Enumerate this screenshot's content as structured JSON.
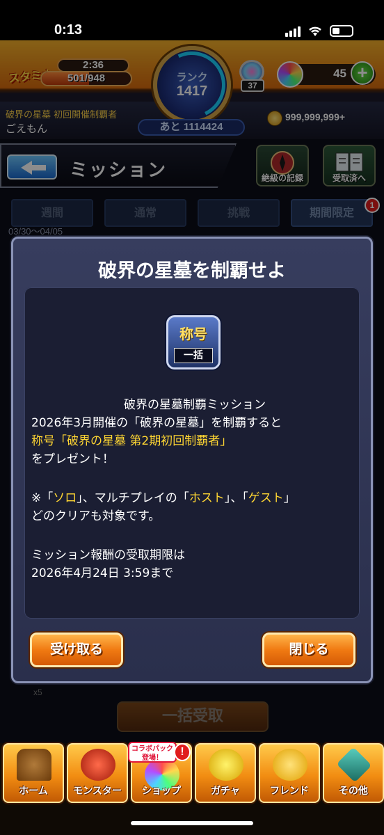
{
  "status_bar": {
    "time": "0:13"
  },
  "header": {
    "stamina_label": "スタミナ",
    "stamina_timer": "2:36",
    "stamina_value": "501/948",
    "stamina_fraction": 0.53,
    "rank_label": "ランク",
    "rank_value": "1417",
    "rank_next": "あと 1114424",
    "bag_count": "37",
    "orb_count": "45",
    "player_title": "破界の星墓 初回開催制覇者",
    "player_name": "ごえもん",
    "gold": "999,999,999+"
  },
  "nav": {
    "page_title": "ミッション",
    "record_label": "絶級の記録",
    "received_label": "受取済へ"
  },
  "tabs": [
    {
      "label": "週間"
    },
    {
      "label": "通常"
    },
    {
      "label": "挑戦"
    },
    {
      "label": "期間限定"
    }
  ],
  "tab_badge": "1",
  "date_range": "03/30〜04/05",
  "modal": {
    "title": "破界の星墓を制覇せよ",
    "reward_top": "称号",
    "reward_bottom": "一括",
    "line1": "破界の星墓制覇ミッション",
    "line2": "2026年3月開催の「破界の星墓」を制覇すると",
    "line3": "称号「破界の星墓 第2期初回制覇者」",
    "line4": "をプレゼント！",
    "line5_a": "※「",
    "line5_b": "ソロ",
    "line5_c": "」、マルチプレイの「",
    "line5_d": "ホスト",
    "line5_e": "」、「",
    "line5_f": "ゲスト",
    "line5_g": "」",
    "line6": "どのクリアも対象です。",
    "line7": "ミッション報酬の受取期限は",
    "line8": "2026年4月24日 3:59まで",
    "receive_label": "受け取る",
    "close_label": "閉じる"
  },
  "behind": {
    "bulk_label": "一括受取",
    "multiplier": "x5"
  },
  "bottom_nav": {
    "items": [
      {
        "label": "ホーム"
      },
      {
        "label": "モンスター"
      },
      {
        "label": "ショップ"
      },
      {
        "label": "ガチャ"
      },
      {
        "label": "フレンド"
      },
      {
        "label": "その他"
      }
    ],
    "collab_line1": "コラボパック",
    "collab_line2": "登場！",
    "alert": "!"
  },
  "colors": {
    "accent_orange": "#f07a12",
    "highlight_yellow": "#ffd633",
    "modal_bg": "#2a2f4c"
  }
}
